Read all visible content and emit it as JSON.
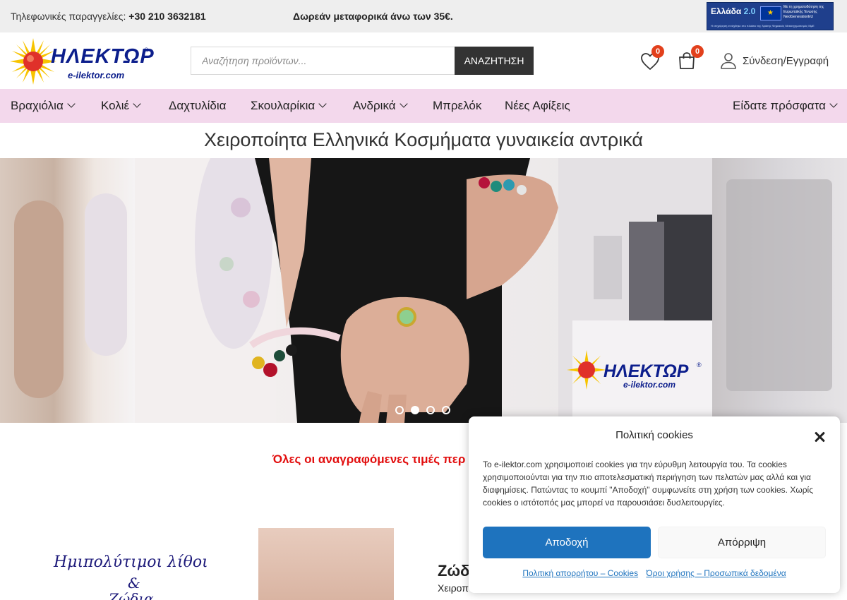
{
  "topbar": {
    "phone_label": "Τηλεφωνικές παραγγελίες:",
    "phone_number": "+30 210 3632181",
    "promo": "Δωρεάν μεταφορικά άνω των 35€.",
    "eu_badge": {
      "title_a": "Ελλάδα",
      "title_b": "2.0",
      "right_text": "Με τη χρηματοδότηση της Ευρωπαϊκής Ένωσης NextGenerationEU",
      "footer_text": "Η επιχείρηση εντάχθηκε στο πλαίσιο της δράσης Ψηφιακός Μετασχηματισμός ΜμΕ"
    }
  },
  "header": {
    "logo_word": "ΗΛΕΚΤΩΡ",
    "logo_reg": "®",
    "logo_site": "e-ilektor.com",
    "search": {
      "placeholder": "Αναζήτηση προϊόντων...",
      "button_label": "ΑΝΑΖΗΤΗΣΗ"
    },
    "wishlist_count": "0",
    "cart_count": "0",
    "login_label": "Σύνδεση/Εγγραφή"
  },
  "nav": {
    "items": [
      {
        "label": "Βραχιόλια",
        "dropdown": true
      },
      {
        "label": "Κολιέ",
        "dropdown": true
      },
      {
        "label": "Δαχτυλίδια",
        "dropdown": false
      },
      {
        "label": "Σκουλαρίκια",
        "dropdown": true
      },
      {
        "label": "Ανδρικά",
        "dropdown": true
      },
      {
        "label": "Μπρελόκ",
        "dropdown": false
      },
      {
        "label": "Νέες Αφίξεις",
        "dropdown": false
      }
    ],
    "recent_label": "Είδατε πρόσφατα"
  },
  "headline": "Χειροποίητα Ελληνικά Κοσμήματα γυναικεία αντρικά",
  "slider": {
    "dot_count": 4,
    "active_index": 1,
    "watermark_word": "ΗΛΕΚΤΩΡ",
    "watermark_reg": "®",
    "watermark_site": "e-ilektor.com"
  },
  "price_note": "Όλες οι αναγραφόμενες τιμές περ",
  "promo": {
    "image_line1": "Ημιπολύτιμοι λίθοι",
    "image_line2": "&",
    "image_line3": "Ζώδια",
    "title": "Ζώδι",
    "subtitle": "Χειροπ"
  },
  "cookie": {
    "title": "Πολιτική cookies",
    "body": "Το e-ilektor.com χρησιμοποιεί cookies για την εύρυθμη λειτουργία του. Τα cookies χρησιμοποιούνται για την πιο αποτελεσματική περιήγηση των πελατών μας αλλά και για διαφημίσεις. Πατώντας το κουμπί \"Αποδοχή\" συμφωνείτε στη χρήση των cookies. Χωρίς cookies ο ιστότοπός μας μπορεί να παρουσιάσει δυσλειτουργίες.",
    "accept_label": "Αποδοχή",
    "deny_label": "Απόρριψη",
    "link_privacy": "Πολιτική απορρήτου – Cookies",
    "link_terms": "Όροι χρήσης – Προσωπικά δεδομένα"
  },
  "colors": {
    "nav_bg": "#f3d8ec",
    "badge": "#e2401c",
    "price_note": "#e20d0d",
    "accept_button": "#1e73be",
    "logo_blue": "#0c1e8c"
  }
}
